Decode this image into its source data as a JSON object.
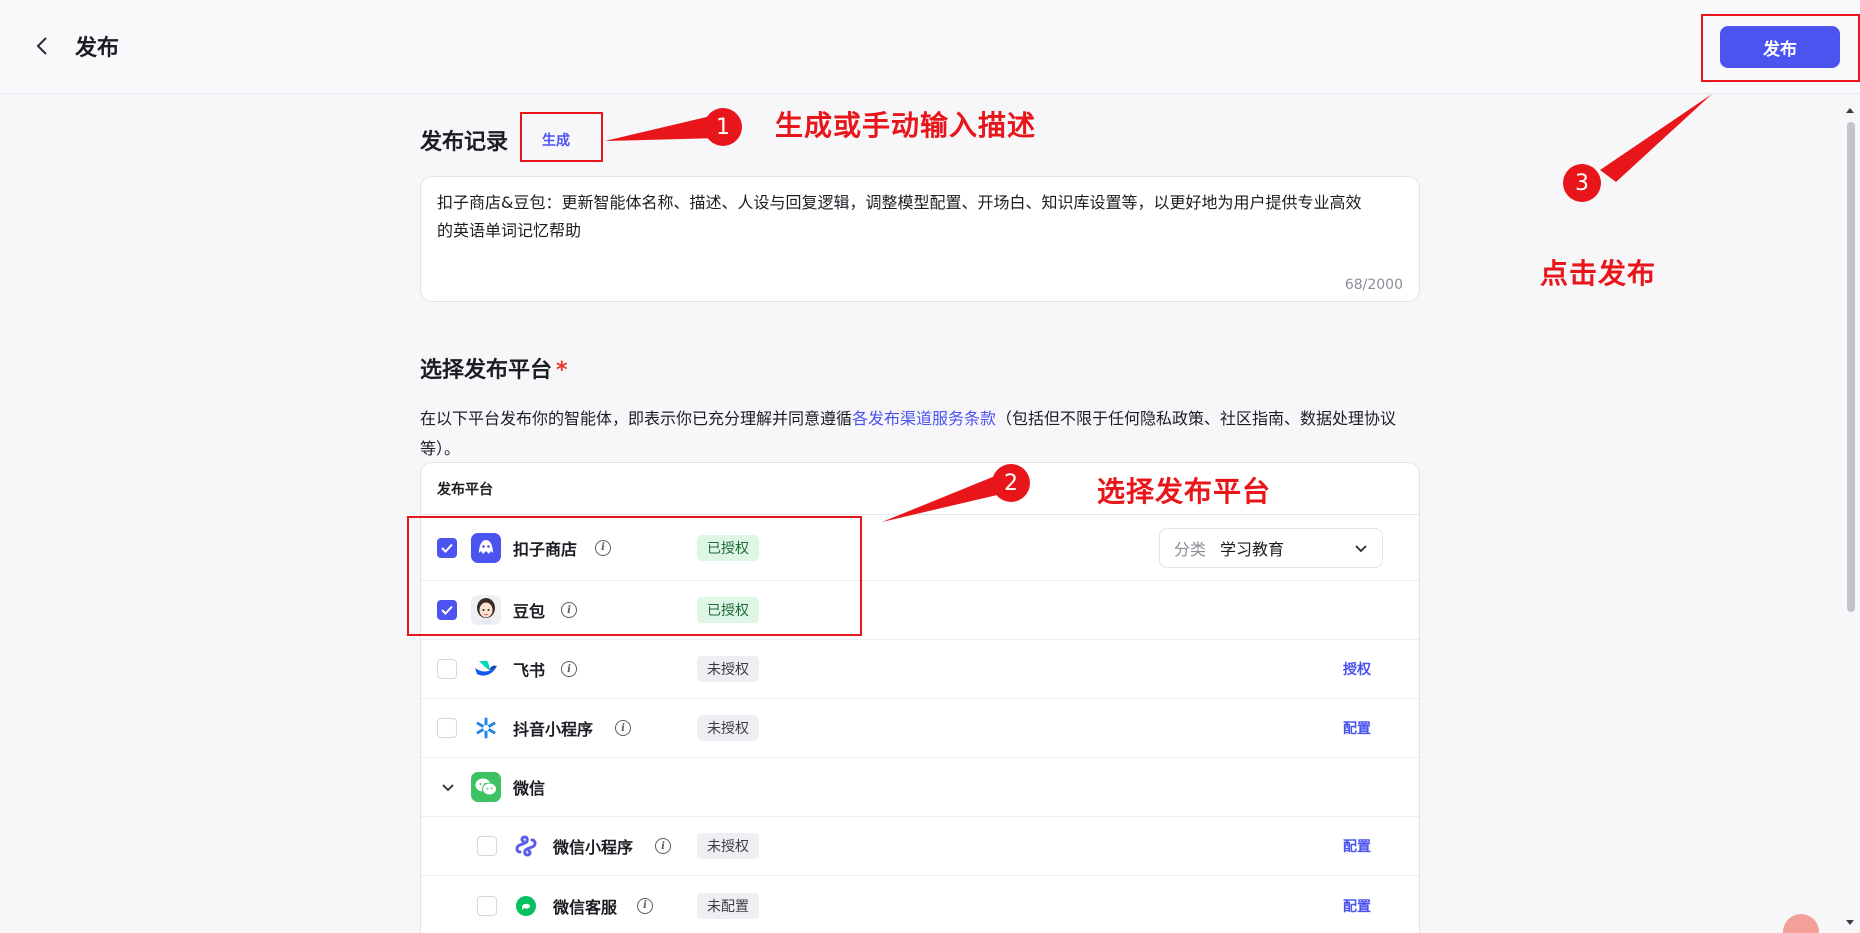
{
  "header": {
    "title": "发布",
    "publish_label": "发布"
  },
  "record": {
    "title": "发布记录",
    "generate_label": "生成",
    "description": "扣子商店&豆包：更新智能体名称、描述、人设与回复逻辑，调整模型配置、开场白、知识库设置等，以更好地为用户提供专业高效的英语单词记忆帮助",
    "char_count": "68/2000"
  },
  "platforms": {
    "title": "选择发布平台",
    "required_mark": "*",
    "notice_before": "在以下平台发布你的智能体，即表示你已充分理解并同意遵循",
    "notice_link": "各发布渠道服务条款",
    "notice_after": "（包括但不限于任何隐私政策、社区指南、数据处理协议等）。",
    "table_header": "发布平台",
    "rows": [
      {
        "name": "扣子商店",
        "status": "已授权",
        "checked": true,
        "icon": "coze-store-icon"
      },
      {
        "name": "豆包",
        "status": "已授权",
        "checked": true,
        "icon": "doubao-avatar-icon"
      },
      {
        "name": "飞书",
        "status": "未授权",
        "checked": false,
        "action": "授权",
        "icon": "feishu-icon"
      },
      {
        "name": "抖音小程序",
        "status": "未授权",
        "checked": false,
        "action": "配置",
        "icon": "douyin-miniapp-icon"
      },
      {
        "name": "微信",
        "icon": "wechat-icon"
      },
      {
        "name": "微信小程序",
        "status": "未授权",
        "checked": false,
        "action": "配置",
        "icon": "wechat-miniapp-icon"
      },
      {
        "name": "微信客服",
        "status": "未配置",
        "checked": false,
        "action": "配置",
        "icon": "wechat-service-icon"
      }
    ],
    "category": {
      "label": "分类",
      "value": "学习教育"
    }
  },
  "annotations": {
    "step1": "1",
    "step1_text": "生成或手动输入描述",
    "step2": "2",
    "step2_text": "选择发布平台",
    "step3": "3",
    "step3_text": "点击发布"
  },
  "colors": {
    "accent": "#4c54f0",
    "annotation": "#e8161b",
    "authorized_bg": "#dff5e6"
  }
}
